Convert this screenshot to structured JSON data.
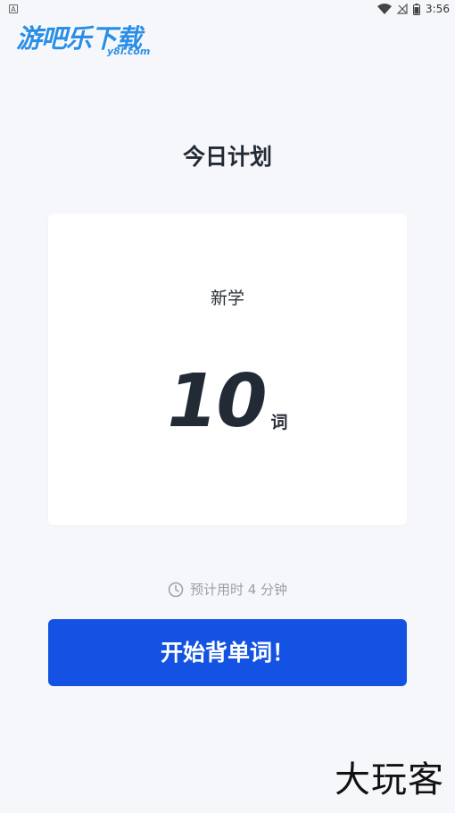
{
  "status_bar": {
    "notification_letter": "A",
    "time": "3:56"
  },
  "logo": {
    "main_text": "游吧乐下载",
    "sub_text": "y8l.com"
  },
  "page": {
    "title": "今日计划"
  },
  "plan_card": {
    "label": "新学",
    "count": "10",
    "unit": "词"
  },
  "estimate": {
    "text": "预计用时 4 分钟"
  },
  "start_button": {
    "label": "开始背单词！"
  },
  "watermark": {
    "text": "大玩客"
  },
  "colors": {
    "background": "#f6f7fa",
    "primary": "#1352e2",
    "text_dark": "#222a36",
    "muted": "#9aa0a8",
    "logo_blue": "#2b8ee6"
  }
}
